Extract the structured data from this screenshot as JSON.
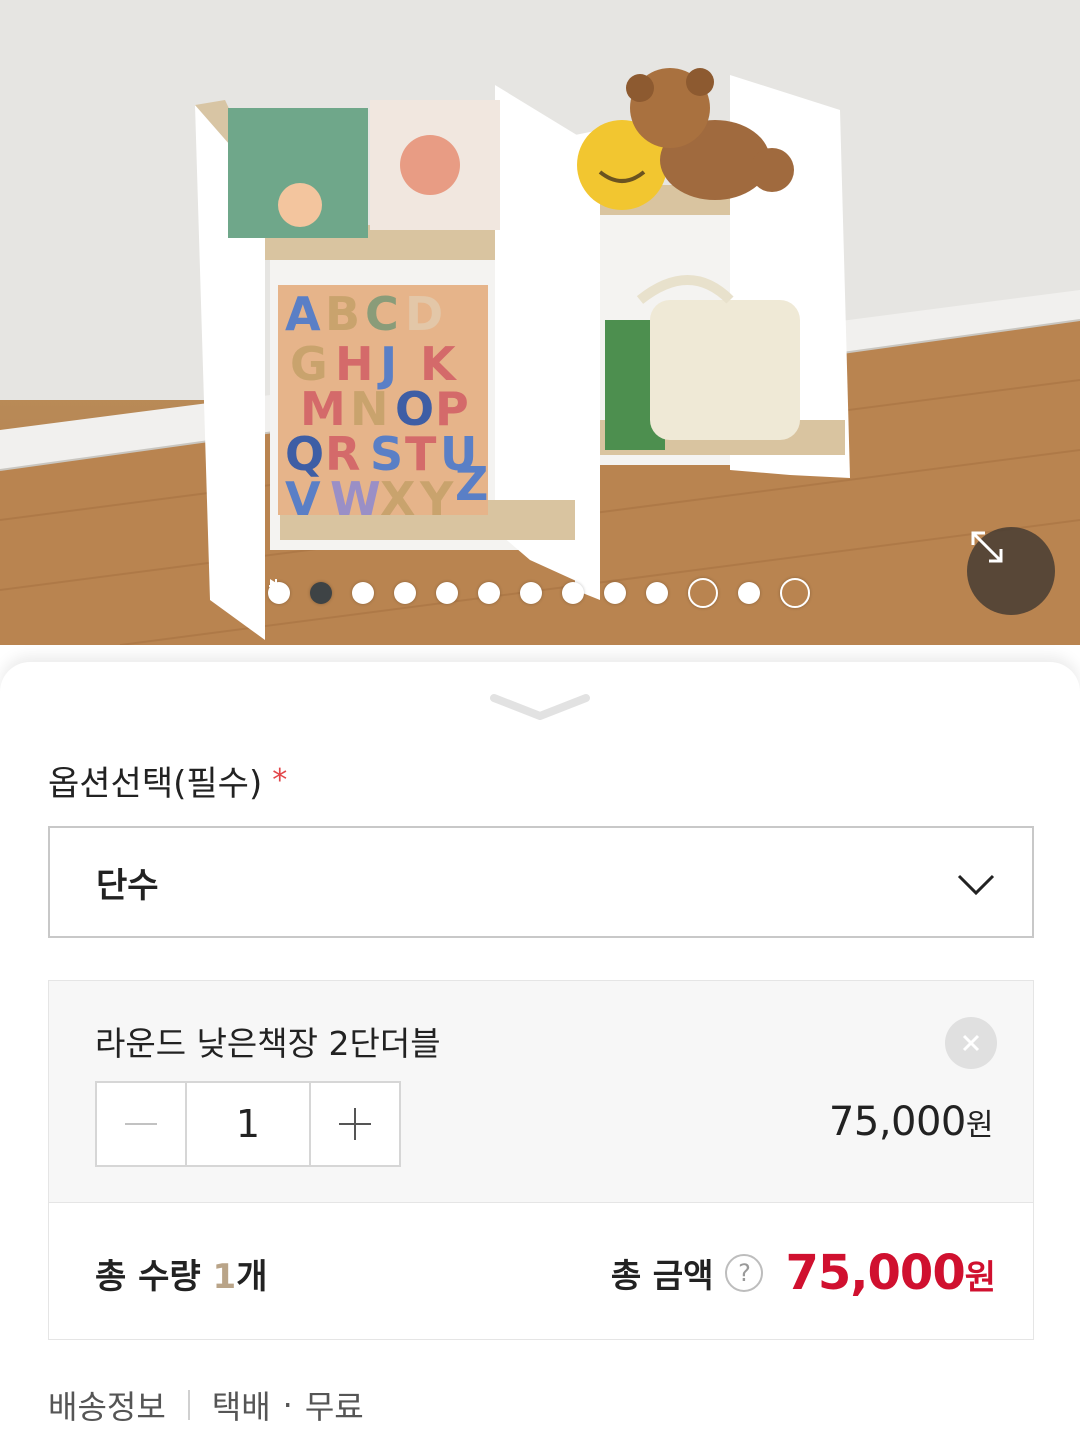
{
  "gallery": {
    "image_alt": "Product photo of a low two-section bookshelf with books, alphabet puzzle, teddy bear and basket",
    "slide_count": 12,
    "active_index": 1,
    "extra_icons": [
      "play-icon",
      "plus-circle-icon"
    ]
  },
  "options": {
    "title": "옵션선택(필수)",
    "required_mark": "*",
    "selected": "단수"
  },
  "item": {
    "name": "라운드 낮은책장 2단더블",
    "quantity": "1",
    "price": "75,000",
    "currency": "원"
  },
  "total": {
    "qty_label": "총 수량",
    "qty_value": "1",
    "qty_unit": "개",
    "amount_label": "총 금액",
    "help_symbol": "?",
    "amount": "75,000",
    "currency": "원"
  },
  "shipping": {
    "label": "배송정보",
    "method": "택배",
    "separator": "·",
    "fee": "무료"
  },
  "colors": {
    "accent_price": "#d0102f",
    "qty_highlight": "#b9a488",
    "required": "#e2464a"
  }
}
